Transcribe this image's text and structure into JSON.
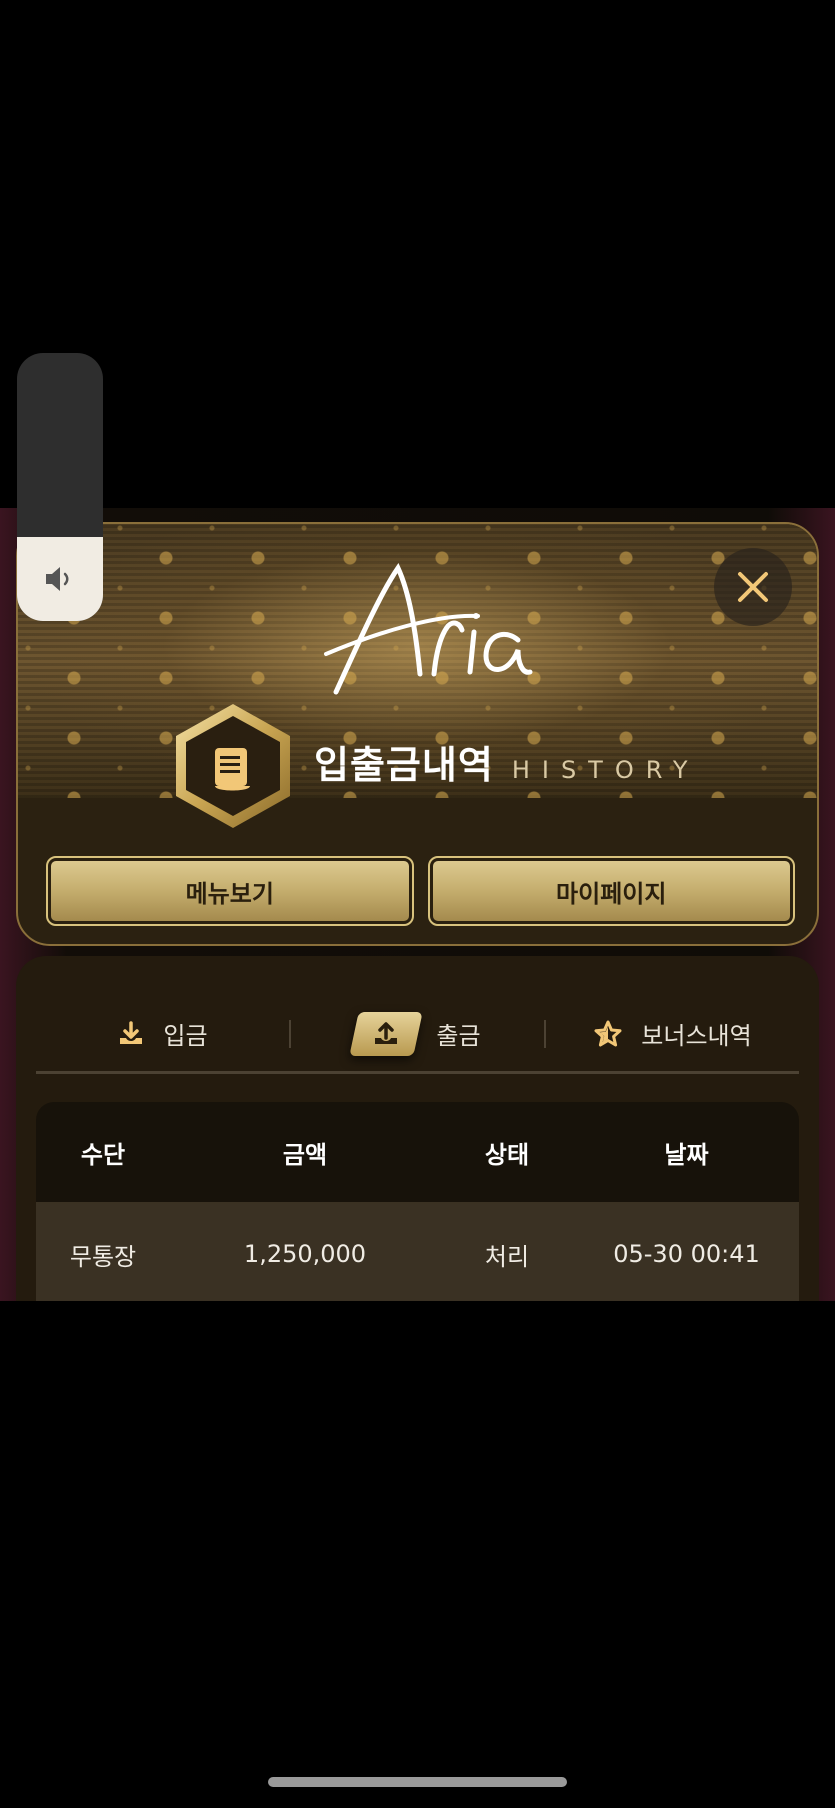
{
  "modal": {
    "logo_text": "Aria",
    "title_kr": "입출금내역",
    "title_en": "HISTORY",
    "buttons": {
      "menu": "메뉴보기",
      "mypage": "마이페이지"
    }
  },
  "tabs": [
    {
      "label": "입금",
      "icon": "download-icon",
      "active": false
    },
    {
      "label": "출금",
      "icon": "upload-icon",
      "active": true
    },
    {
      "label": "보너스내역",
      "icon": "star-icon",
      "active": false
    }
  ],
  "table": {
    "headers": [
      "수단",
      "금액",
      "상태",
      "날짜"
    ],
    "rows": [
      [
        "무통장",
        "1,250,000",
        "처리",
        "05-30 00:41"
      ]
    ]
  },
  "volume": {
    "icon": "speaker-icon",
    "level": 0.31
  },
  "colors": {
    "gold": "#d8c27d",
    "accent_icon": "#f2c777",
    "panel": "#241b0e"
  }
}
